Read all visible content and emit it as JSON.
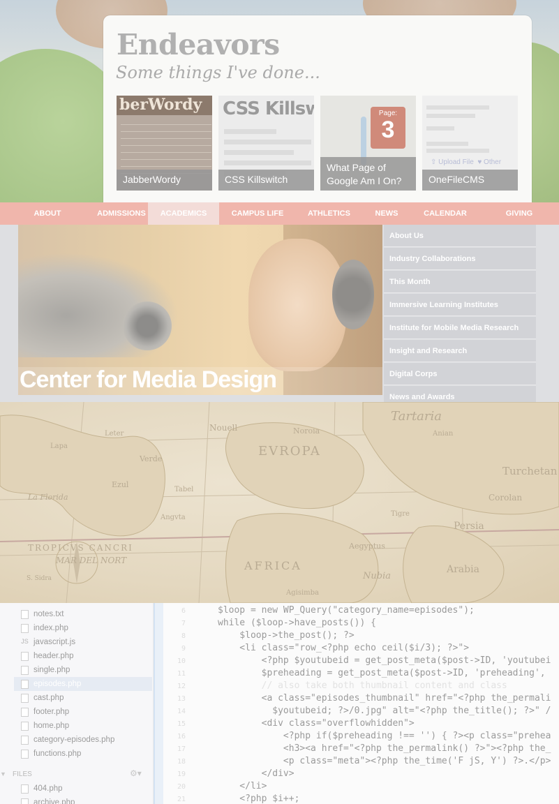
{
  "portfolio": {
    "title": "Endeavors",
    "subtitle": "Some things I've done...",
    "thumbs": [
      {
        "caption": "JabberWordy",
        "heading": "berWordy"
      },
      {
        "caption": "CSS Killswitch",
        "heading": "CSS Killswitch"
      },
      {
        "caption_line1": "What Page of",
        "caption_line2": "Google Am I On?",
        "badge_label": "Page:",
        "badge_number": "3"
      },
      {
        "caption": "OneFileCMS",
        "upload": "Upload File",
        "other": "Other"
      }
    ]
  },
  "university": {
    "nav": [
      {
        "label": "About"
      },
      {
        "label": "Admissions"
      },
      {
        "label": "Academics",
        "active": true
      },
      {
        "label": "Campus Life"
      },
      {
        "label": "Athletics"
      },
      {
        "label": "News"
      },
      {
        "label": "Calendar"
      },
      {
        "label": "Giving"
      }
    ],
    "hero_title": "Center for Media Design",
    "submenu": [
      "About Us",
      "Industry Collaborations",
      "This Month",
      "Immersive Learning Institutes",
      "Institute for Mobile Media Research",
      "Insight and Research",
      "Digital Corps",
      "News and Awards"
    ]
  },
  "map": {
    "labels": [
      "Tartaria",
      "EVROPA",
      "Nouell",
      "Noroia",
      "La Florida",
      "TROPICVS CANCRI",
      "Verde",
      "Ezul",
      "Lapa",
      "Leter",
      "Tabel",
      "S. Sidra",
      "Angvta",
      "MAR DEL NORT",
      "AFRICA",
      "Nubia",
      "Arabia",
      "Agisimba",
      "Anian",
      "Turchetan",
      "Corolan",
      "Persia",
      "Aegyptus",
      "Tigre"
    ]
  },
  "editor": {
    "files": [
      {
        "name": "notes.txt",
        "icon": "text-file-icon"
      },
      {
        "name": "index.php",
        "icon": "php-file-icon"
      },
      {
        "name": "javascript.js",
        "icon": "js-file-icon"
      },
      {
        "name": "header.php",
        "icon": "php-file-icon"
      },
      {
        "name": "single.php",
        "icon": "php-file-icon"
      },
      {
        "name": "episodes.php",
        "icon": "php-file-icon",
        "selected": true
      },
      {
        "name": "cast.php",
        "icon": "php-file-icon"
      },
      {
        "name": "footer.php",
        "icon": "php-file-icon"
      },
      {
        "name": "home.php",
        "icon": "php-file-icon"
      },
      {
        "name": "category-episodes.php",
        "icon": "php-file-icon"
      },
      {
        "name": "functions.php",
        "icon": "php-file-icon"
      }
    ],
    "files_header": "FILES",
    "files_section": [
      {
        "name": "404.php"
      },
      {
        "name": "archive.php"
      }
    ],
    "code_lines": [
      {
        "no": "6",
        "text": "$loop = new WP_Query(\"category_name=episodes\");"
      },
      {
        "no": "7",
        "text": "while ($loop->have_posts()) {"
      },
      {
        "no": "8",
        "text": "    $loop->the_post(); ?>"
      },
      {
        "no": "9",
        "text": "    <li class=\"row_<?php echo ceil($i/3); ?>\">"
      },
      {
        "no": "10",
        "text": "        <?php $youtubeid = get_post_meta($post->ID, 'youtubei"
      },
      {
        "no": "11",
        "text": "        $preheading = get_post_meta($post->ID, 'preheading',"
      },
      {
        "no": "12",
        "text": "        // also take both thumbnail content and class"
      },
      {
        "no": "13",
        "text": "        <a class=\"episodes_thumbnail\" href=\"<?php the_permali"
      },
      {
        "no": "14",
        "text": "          $youtubeid; ?>/0.jpg\" alt=\"<?php the_title(); ?>\" /"
      },
      {
        "no": "15",
        "text": "        <div class=\"overflowhidden\">"
      },
      {
        "no": "16",
        "text": "            <?php if($preheading !== '') { ?><p class=\"prehea"
      },
      {
        "no": "17",
        "text": "            <h3><a href=\"<?php the_permalink() ?>\"><?php the_"
      },
      {
        "no": "18",
        "text": "            <p class=\"meta\"><?php the_time('F jS, Y') ?>.</p>"
      },
      {
        "no": "19",
        "text": "        </div>"
      },
      {
        "no": "20",
        "text": "    </li>"
      },
      {
        "no": "21",
        "text": "    <?php $i++;"
      }
    ]
  },
  "colors": {
    "nav_bg": "#f0b6ac",
    "nav_active": "#f3dcd8",
    "submenu_bg": "#d2d3d7",
    "card_bg": "#f9f9f7"
  }
}
